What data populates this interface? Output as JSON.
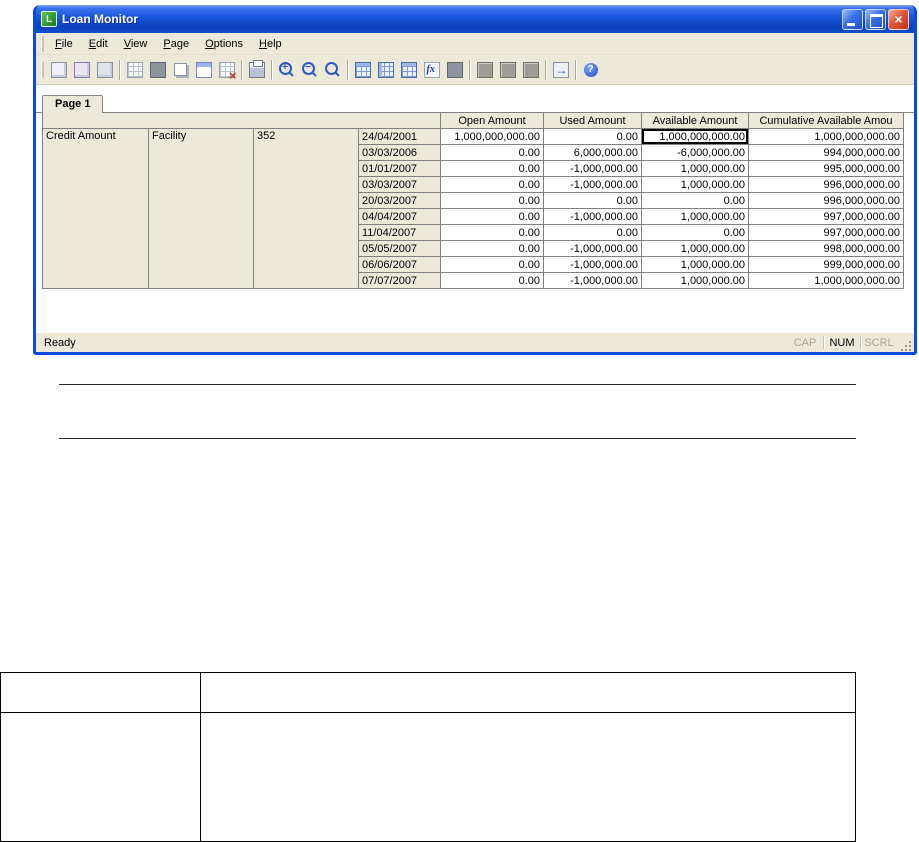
{
  "window": {
    "title": "Loan Monitor",
    "icon_letter": "L"
  },
  "menu": {
    "items": [
      "File",
      "Edit",
      "View",
      "Page",
      "Options",
      "Help"
    ]
  },
  "toolbar": {
    "groups": [
      [
        "new-report-icon",
        "open-report-icon",
        "save-report-icon"
      ],
      [
        "grid-icon",
        "fill-grid-icon",
        "copy-grid-icon",
        "paste-grid-icon",
        "delete-grid-icon"
      ],
      [
        "print-icon"
      ],
      [
        "zoom-in-icon",
        "zoom-out-icon",
        "zoom-custom-icon"
      ],
      [
        "table-icon",
        "table-columns-icon",
        "table-rows-icon",
        "formula-icon",
        "chart-icon"
      ],
      [
        "block-a-icon",
        "block-b-icon",
        "block-c-icon"
      ],
      [
        "go-icon"
      ],
      [
        "help-icon"
      ]
    ]
  },
  "tabs": {
    "page1": "Page 1"
  },
  "grid": {
    "headers": [
      "Open Amount",
      "Used Amount",
      "Available Amount",
      "Cumulative Available Amou"
    ],
    "left": [
      "Credit Amount",
      "Facility",
      "352"
    ],
    "rows": [
      {
        "date": "24/04/2001",
        "open": "1,000,000,000.00",
        "used": "0.00",
        "available": "1,000,000,000.00",
        "cumulative": "1,000,000,000.00"
      },
      {
        "date": "03/03/2006",
        "open": "0.00",
        "used": "6,000,000.00",
        "available": "-6,000,000.00",
        "cumulative": "994,000,000.00"
      },
      {
        "date": "01/01/2007",
        "open": "0.00",
        "used": "-1,000,000.00",
        "available": "1,000,000.00",
        "cumulative": "995,000,000.00"
      },
      {
        "date": "03/03/2007",
        "open": "0.00",
        "used": "-1,000,000.00",
        "available": "1,000,000.00",
        "cumulative": "996,000,000.00"
      },
      {
        "date": "20/03/2007",
        "open": "0.00",
        "used": "0.00",
        "available": "0.00",
        "cumulative": "996,000,000.00"
      },
      {
        "date": "04/04/2007",
        "open": "0.00",
        "used": "-1,000,000.00",
        "available": "1,000,000.00",
        "cumulative": "997,000,000.00"
      },
      {
        "date": "11/04/2007",
        "open": "0.00",
        "used": "0.00",
        "available": "0.00",
        "cumulative": "997,000,000.00"
      },
      {
        "date": "05/05/2007",
        "open": "0.00",
        "used": "-1,000,000.00",
        "available": "1,000,000.00",
        "cumulative": "998,000,000.00"
      },
      {
        "date": "06/06/2007",
        "open": "0.00",
        "used": "-1,000,000.00",
        "available": "1,000,000.00",
        "cumulative": "999,000,000.00"
      },
      {
        "date": "07/07/2007",
        "open": "0.00",
        "used": "-1,000,000.00",
        "available": "1,000,000.00",
        "cumulative": "1,000,000,000.00"
      }
    ]
  },
  "statusbar": {
    "ready": "Ready",
    "cap": "CAP",
    "num": "NUM",
    "scrl": "SCRL"
  }
}
